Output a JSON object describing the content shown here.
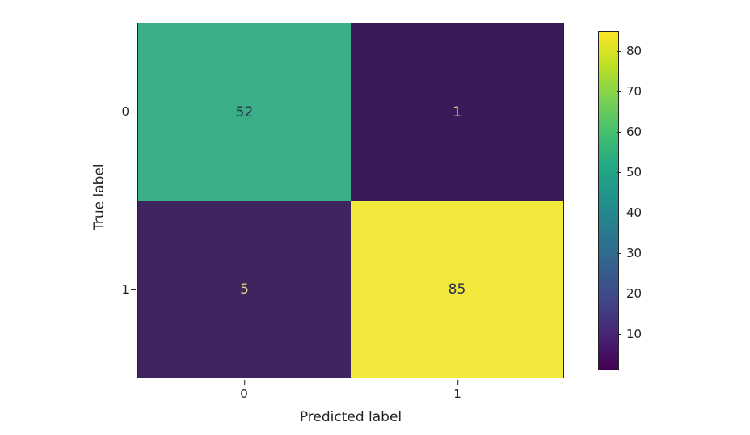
{
  "chart_data": {
    "type": "heatmap",
    "xlabel": "Predicted label",
    "ylabel": "True label",
    "x_categories": [
      "0",
      "1"
    ],
    "y_categories": [
      "0",
      "1"
    ],
    "matrix": [
      [
        52,
        1
      ],
      [
        5,
        85
      ]
    ],
    "colorbar": {
      "vmin": 1,
      "vmax": 85,
      "ticks": [
        10,
        20,
        30,
        40,
        50,
        60,
        70,
        80
      ]
    },
    "cell_colors": [
      [
        "#3aae86",
        "#3a1b59"
      ],
      [
        "#3f2460",
        "#f2e93c"
      ]
    ],
    "cell_text_colors": [
      [
        "#2c2c4c",
        "#d8d37a"
      ],
      [
        "#d8d37a",
        "#2c2c4c"
      ]
    ],
    "viridis_stops": [
      {
        "pos": 0,
        "color": "#440154"
      },
      {
        "pos": 0.1,
        "color": "#482475"
      },
      {
        "pos": 0.2,
        "color": "#414487"
      },
      {
        "pos": 0.3,
        "color": "#355f8d"
      },
      {
        "pos": 0.4,
        "color": "#2a788e"
      },
      {
        "pos": 0.5,
        "color": "#21918c"
      },
      {
        "pos": 0.6,
        "color": "#22a884"
      },
      {
        "pos": 0.7,
        "color": "#44bf70"
      },
      {
        "pos": 0.8,
        "color": "#7ad151"
      },
      {
        "pos": 0.9,
        "color": "#bddf26"
      },
      {
        "pos": 1.0,
        "color": "#fde725"
      }
    ]
  }
}
